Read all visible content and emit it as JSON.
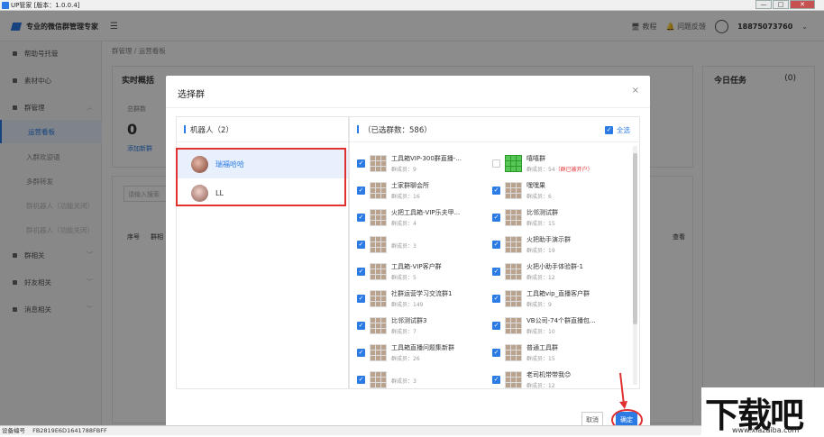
{
  "window": {
    "title": "UP管家 [版本：1.0.0.4]",
    "min": "—",
    "max": "□",
    "close": "✕"
  },
  "header": {
    "brand": "专业的微信群管理专家",
    "menu_icon": "hamburger-icon",
    "tutorial": "教程",
    "feedback": "问题反馈",
    "phone": "18875073760",
    "dropdown": "⌄"
  },
  "sidebar": {
    "items": [
      {
        "label": "帮助号托管"
      },
      {
        "label": "素材中心"
      },
      {
        "label": "群管理"
      },
      {
        "label": "运营看板"
      },
      {
        "label": "入群欢迎语"
      },
      {
        "label": "多群转发"
      },
      {
        "label": "群机器人（功能关闭）"
      },
      {
        "label": "群机器人（功能关闭）"
      },
      {
        "label": "群相关"
      },
      {
        "label": "好友相关"
      },
      {
        "label": "消息相关"
      }
    ]
  },
  "background": {
    "breadcrumb": "群管理 / 运营看板",
    "overview_title": "实时概括",
    "total_label": "总群数",
    "total_value": "0",
    "add_group": "添加新群",
    "tasks_title": "今日任务",
    "tasks_count": "(0)",
    "search_placeholder": "请输入搜索",
    "col_index": "序号",
    "col_group": "群相",
    "col_view": "查看"
  },
  "modal": {
    "title": "选择群",
    "close": "×",
    "left_header": "机器人（2）",
    "bots": [
      {
        "name": "瑞福哈哈",
        "selected": true
      },
      {
        "name": "LL",
        "selected": false
      }
    ],
    "right_header": "（已选群数：586）",
    "select_all": "全选",
    "groups_left": [
      {
        "name": "工具箱VIP-300群直播-...",
        "count": "群成员：9",
        "checked": true
      },
      {
        "name": "土家群聊会所",
        "count": "群成员：16",
        "checked": true
      },
      {
        "name": "火把工具箱-VIP乐夫甲...",
        "count": "群成员：4",
        "checked": true
      },
      {
        "name": "",
        "count": "群成员：3",
        "checked": true
      },
      {
        "name": "工具箱-VIP客户群",
        "count": "群成员：5",
        "checked": true
      },
      {
        "name": "社群运营学习交流群1",
        "count": "群成员：149",
        "checked": true
      },
      {
        "name": "比邻测试群3",
        "count": "群成员：7",
        "checked": true
      },
      {
        "name": "工具箱直播问题集新群",
        "count": "群成员：26",
        "checked": true
      },
      {
        "name": "",
        "count": "群成员：3",
        "checked": true
      }
    ],
    "groups_right": [
      {
        "name": "嘻嘻群",
        "count": "群成员：54",
        "warn": "（群已被开户）",
        "checked": false,
        "green": true
      },
      {
        "name": "嘿嘿果",
        "count": "群成员：6",
        "checked": true
      },
      {
        "name": "比邻测试群",
        "count": "群成员：15",
        "checked": true
      },
      {
        "name": "火把助手演示群",
        "count": "群成员：19",
        "checked": true
      },
      {
        "name": "火把小助手体验群-1",
        "count": "群成员：12",
        "checked": true
      },
      {
        "name": "工具箱vip_直播客户群",
        "count": "群成员：9",
        "checked": true
      },
      {
        "name": "VB公司-74个群直播包...",
        "count": "群成员：10",
        "checked": true
      },
      {
        "name": "普通工具群",
        "count": "群成员：15",
        "checked": true
      },
      {
        "name": "老司机带带我😊",
        "count": "群成员：12",
        "checked": true
      }
    ],
    "cancel": "取消",
    "confirm": "确定"
  },
  "statusbar": {
    "device_label": "设备编号",
    "device_id": "FB2819E6D1641788FBFF"
  },
  "watermark": {
    "big": "下载吧",
    "url": "www.xiazaiba.com"
  }
}
